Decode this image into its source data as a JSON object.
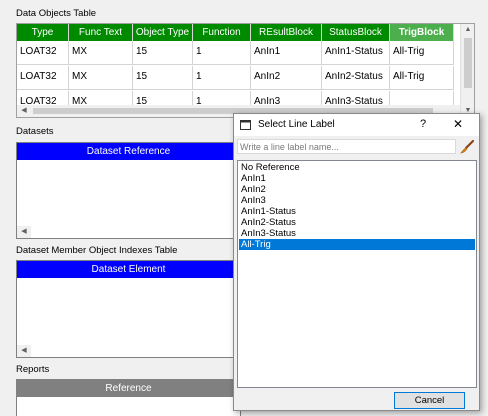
{
  "data_objects": {
    "section_label": "Data Objects Table",
    "columns": [
      "Type",
      "Func Text",
      "Object Type",
      "Function",
      "REsultBlock",
      "StatusBlock",
      "TrigBlock"
    ],
    "rows": [
      [
        "LOAT32",
        "MX",
        "15",
        "1",
        "AnIn1",
        "AnIn1-Status",
        "All-Trig"
      ],
      [
        "LOAT32",
        "MX",
        "15",
        "1",
        "AnIn2",
        "AnIn2-Status",
        "All-Trig"
      ],
      [
        "LOAT32",
        "MX",
        "15",
        "1",
        "AnIn3",
        "AnIn3-Status",
        ""
      ]
    ]
  },
  "datasets": {
    "section_label": "Datasets",
    "header": "Dataset Reference"
  },
  "member_indexes": {
    "section_label": "Dataset Member Object Indexes Table",
    "header": "Dataset Element"
  },
  "reports": {
    "section_label": "Reports",
    "header": "Reference"
  },
  "dialog": {
    "title": "Select Line Label",
    "help_glyph": "?",
    "close_glyph": "✕",
    "search_placeholder": "Write a line label name...",
    "items": [
      "No Reference",
      "AnIn1",
      "AnIn2",
      "AnIn3",
      "AnIn1-Status",
      "AnIn2-Status",
      "AnIn3-Status",
      "All-Trig"
    ],
    "selected_item": "All-Trig",
    "cancel_label": "Cancel"
  },
  "colors": {
    "table_header": "#008a00",
    "active_header": "#4cae4c",
    "blue_header": "#0000ff",
    "gray_header": "#808080",
    "selection": "#0078d7"
  },
  "icons": {
    "dialog_icon": "window-icon",
    "brush": "brush-icon",
    "scroll_up": "arrow-up-icon",
    "scroll_down": "arrow-down-icon",
    "scroll_left": "arrow-left-icon",
    "scroll_right": "arrow-right-icon"
  }
}
